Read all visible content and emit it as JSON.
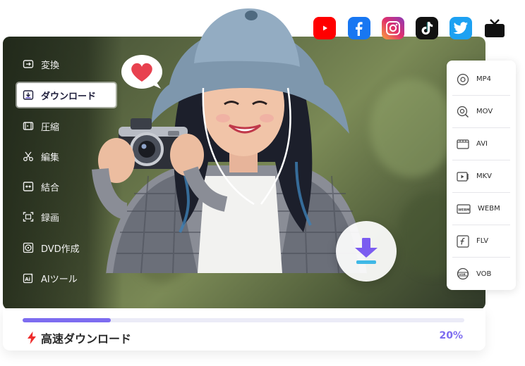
{
  "sidebar": {
    "items": [
      {
        "label": "変換",
        "icon": "convert-icon",
        "active": false
      },
      {
        "label": "ダウンロード",
        "icon": "download-icon",
        "active": true
      },
      {
        "label": "圧縮",
        "icon": "compress-icon",
        "active": false
      },
      {
        "label": "編集",
        "icon": "scissors-icon",
        "active": false
      },
      {
        "label": "結合",
        "icon": "merge-icon",
        "active": false
      },
      {
        "label": "録画",
        "icon": "record-icon",
        "active": false
      },
      {
        "label": "DVD作成",
        "icon": "dvd-icon",
        "active": false
      },
      {
        "label": "AIツール",
        "icon": "ai-icon",
        "active": false
      }
    ]
  },
  "social": [
    {
      "name": "youtube-icon",
      "color": "#ff0000"
    },
    {
      "name": "facebook-icon",
      "color": "#1877f2"
    },
    {
      "name": "instagram-icon",
      "color": "#e1306c"
    },
    {
      "name": "tiktok-icon",
      "color": "#111111"
    },
    {
      "name": "twitter-icon",
      "color": "#1da1f2"
    },
    {
      "name": "tv-icon",
      "color": "#111111"
    }
  ],
  "formats": [
    {
      "label": "MP4",
      "icon": "mp4-icon"
    },
    {
      "label": "MOV",
      "icon": "mov-icon"
    },
    {
      "label": "AVI",
      "icon": "avi-icon"
    },
    {
      "label": "MKV",
      "icon": "mkv-icon"
    },
    {
      "label": "WEBM",
      "icon": "webm-icon"
    },
    {
      "label": "FLV",
      "icon": "flv-icon"
    },
    {
      "label": "VOB",
      "icon": "vob-icon"
    }
  ],
  "download": {
    "label": "高速ダウンロード",
    "percent_text": "20%",
    "progress": 0.2
  },
  "colors": {
    "accent": "#7d6cf0",
    "fab_arrow": "#7b5cf0",
    "heart": "#e8414f"
  }
}
